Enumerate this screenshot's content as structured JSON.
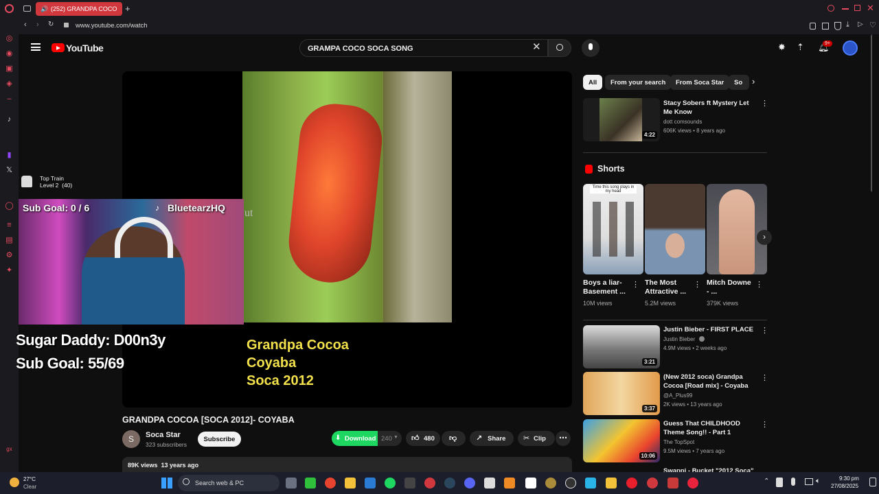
{
  "browser": {
    "tab_title": "(252) GRANDPA COCO",
    "new_tab": "+",
    "url": "www.youtube.com/watch"
  },
  "header": {
    "logo_text": "YouTube",
    "search_value": "GRAMPA COCO SOCA SONG",
    "notif_count": "9+"
  },
  "video": {
    "overlay_lines": [
      "Grandpa Cocoa",
      "Coyaba",
      "Soca 2012"
    ],
    "ghost_text": "ut",
    "title": "GRANDPA COCOA [SOCA 2012]- COYABA",
    "channel": "Soca Star",
    "channel_initial": "S",
    "subscribers": "323 subscribers",
    "subscribe_label": "Subscribe",
    "download_label": "Download",
    "quality": "240",
    "likes": "480",
    "share_label": "Share",
    "clip_label": "Clip",
    "description_meta": "89K views  13 years ago"
  },
  "stream_overlay": {
    "train_label": "Top Train",
    "train_level": "Level 2  (40)",
    "sub_goal_top": "Sub Goal: 0 / 6",
    "tiktok_name": "BluetearzHQ",
    "donor_line": "Sugar Daddy: D00n3y",
    "sub_goal_bottom": "Sub Goal: 55/69"
  },
  "chips": [
    "All",
    "From your search",
    "From Soca Star",
    "So"
  ],
  "recommended": [
    {
      "title": "Stacy Sobers ft Mystery Let Me Know",
      "channel": "dott comsounds",
      "meta": "606K views • 8 years ago",
      "duration": "4:22"
    },
    {
      "title": "Justin Bieber - FIRST PLACE",
      "channel": "Justin Bieber",
      "meta": "4.9M views • 2 weeks ago",
      "duration": "3:21"
    },
    {
      "title": "(New 2012 soca) Grandpa Cocoa [Road mix] - Coyaba",
      "channel": "@A_Plus99",
      "meta": "2K views • 13 years ago",
      "duration": "3:37"
    },
    {
      "title": "Guess That CHILDHOOD Theme Song!! - Part 1",
      "channel": "The TopSpot",
      "meta": "9.5M views • 7 years ago",
      "duration": "10:06"
    },
    {
      "title": "Swappi - Bucket \"2012 Soca\"",
      "channel": "",
      "meta": "",
      "duration": ""
    }
  ],
  "shorts": {
    "heading": "Shorts",
    "items": [
      {
        "title": "Boys a liar- Basement ...",
        "views": "10M views",
        "caption": "Time this song plays in my head"
      },
      {
        "title": "The Most Attractive ...",
        "views": "5.2M views",
        "caption": ""
      },
      {
        "title": "Mitch Downe - ...",
        "views": "379K views",
        "caption": ""
      }
    ]
  },
  "taskbar": {
    "weather_temp": "27°C",
    "weather_desc": "Clear",
    "search_placeholder": "Search web & PC",
    "time": "9:30 pm",
    "date": "27/08/2025"
  },
  "colors": {
    "yt_red": "#ff0000",
    "download_green": "#1ed760",
    "tab_red": "#d0383e",
    "overlay_yellow": "#f2e14a"
  }
}
